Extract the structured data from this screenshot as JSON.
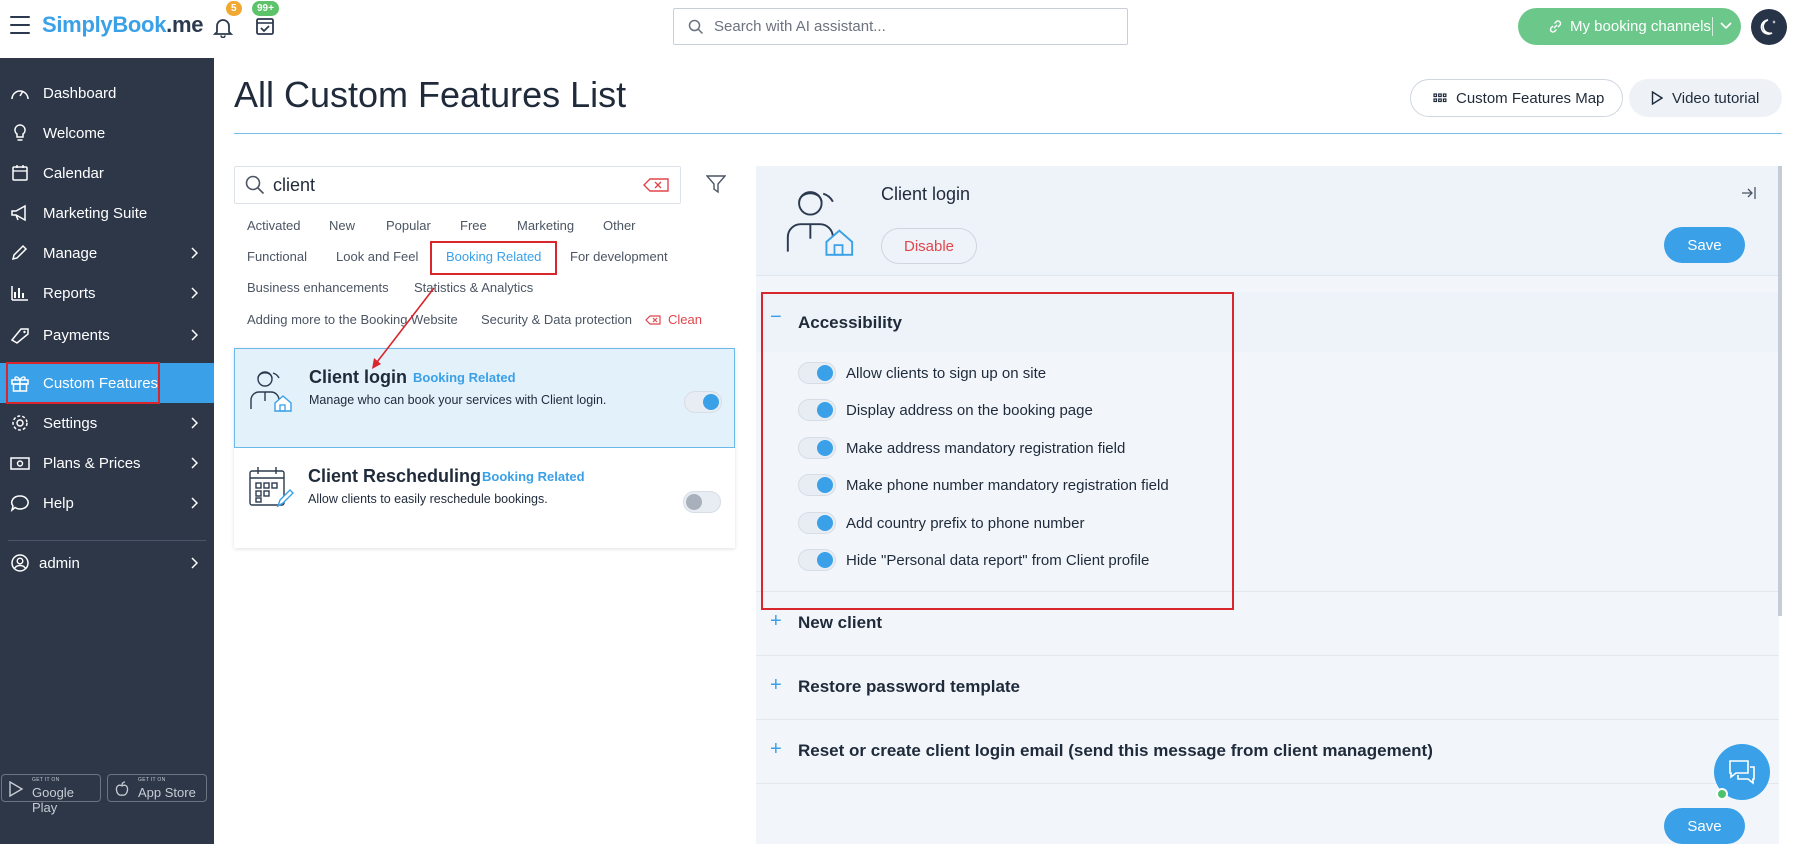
{
  "app": {
    "logo_main": "SimplyBook",
    "logo_suffix": ".me",
    "notifications_count": "5",
    "tasks_count": "99+",
    "search_placeholder": "Search with AI assistant...",
    "channels_label": "My booking channels"
  },
  "sidebar": {
    "items": [
      {
        "label": "Dashboard",
        "icon": "dashboard-icon"
      },
      {
        "label": "Welcome",
        "icon": "lightbulb-icon"
      },
      {
        "label": "Calendar",
        "icon": "calendar-icon"
      },
      {
        "label": "Marketing Suite",
        "icon": "megaphone-icon"
      },
      {
        "label": "Manage",
        "icon": "pencil-icon"
      },
      {
        "label": "Reports",
        "icon": "bar-chart-icon"
      },
      {
        "label": "Payments",
        "icon": "tag-icon"
      },
      {
        "label": "Custom Features",
        "icon": "gift-icon"
      },
      {
        "label": "Settings",
        "icon": "gear-icon"
      },
      {
        "label": "Plans & Prices",
        "icon": "money-icon"
      },
      {
        "label": "Help",
        "icon": "chat-bubble-icon"
      }
    ],
    "user": "admin",
    "stores": [
      {
        "small": "GET IT ON",
        "big": "Google Play"
      },
      {
        "small": "GET IT ON",
        "big": "App Store"
      }
    ]
  },
  "main": {
    "title": "All Custom Features List",
    "map_button": "Custom Features Map",
    "video_button": "Video tutorial",
    "search_value": "client",
    "filters": [
      "Activated",
      "New",
      "Popular",
      "Free",
      "Marketing",
      "Other",
      "Functional",
      "Look and Feel",
      "Booking Related",
      "For development",
      "Business enhancements",
      "Statistics & Analytics",
      "Adding more to the Booking Website",
      "Security & Data protection",
      "Clean"
    ],
    "features": [
      {
        "title": "Client login",
        "tag": "Booking Related",
        "desc": "Manage who can book your services with Client login.",
        "enabled": true
      },
      {
        "title": "Client Rescheduling",
        "tag": "Booking Related",
        "desc": "Allow clients to easily reschedule bookings.",
        "enabled": false
      }
    ]
  },
  "detail": {
    "title": "Client login",
    "disable_label": "Disable",
    "save_label": "Save",
    "sections": [
      {
        "title": "Accessibility",
        "expanded": true,
        "options": [
          "Allow clients to sign up on site",
          "Display address on the booking page",
          "Make address mandatory registration field",
          "Make phone number mandatory registration field",
          "Add country prefix to phone number",
          "Hide \"Personal data report\" from Client profile"
        ]
      },
      {
        "title": "New client",
        "expanded": false
      },
      {
        "title": "Restore password template",
        "expanded": false
      },
      {
        "title": "Reset or create client login email (send this message from client management)",
        "expanded": false
      }
    ],
    "expand_sign": "+",
    "collapse_sign": "−"
  },
  "colors": {
    "accent": "#3aa0e8",
    "sidebar": "#2d3748",
    "channels": "#6cc88a",
    "danger": "#e0464c"
  }
}
